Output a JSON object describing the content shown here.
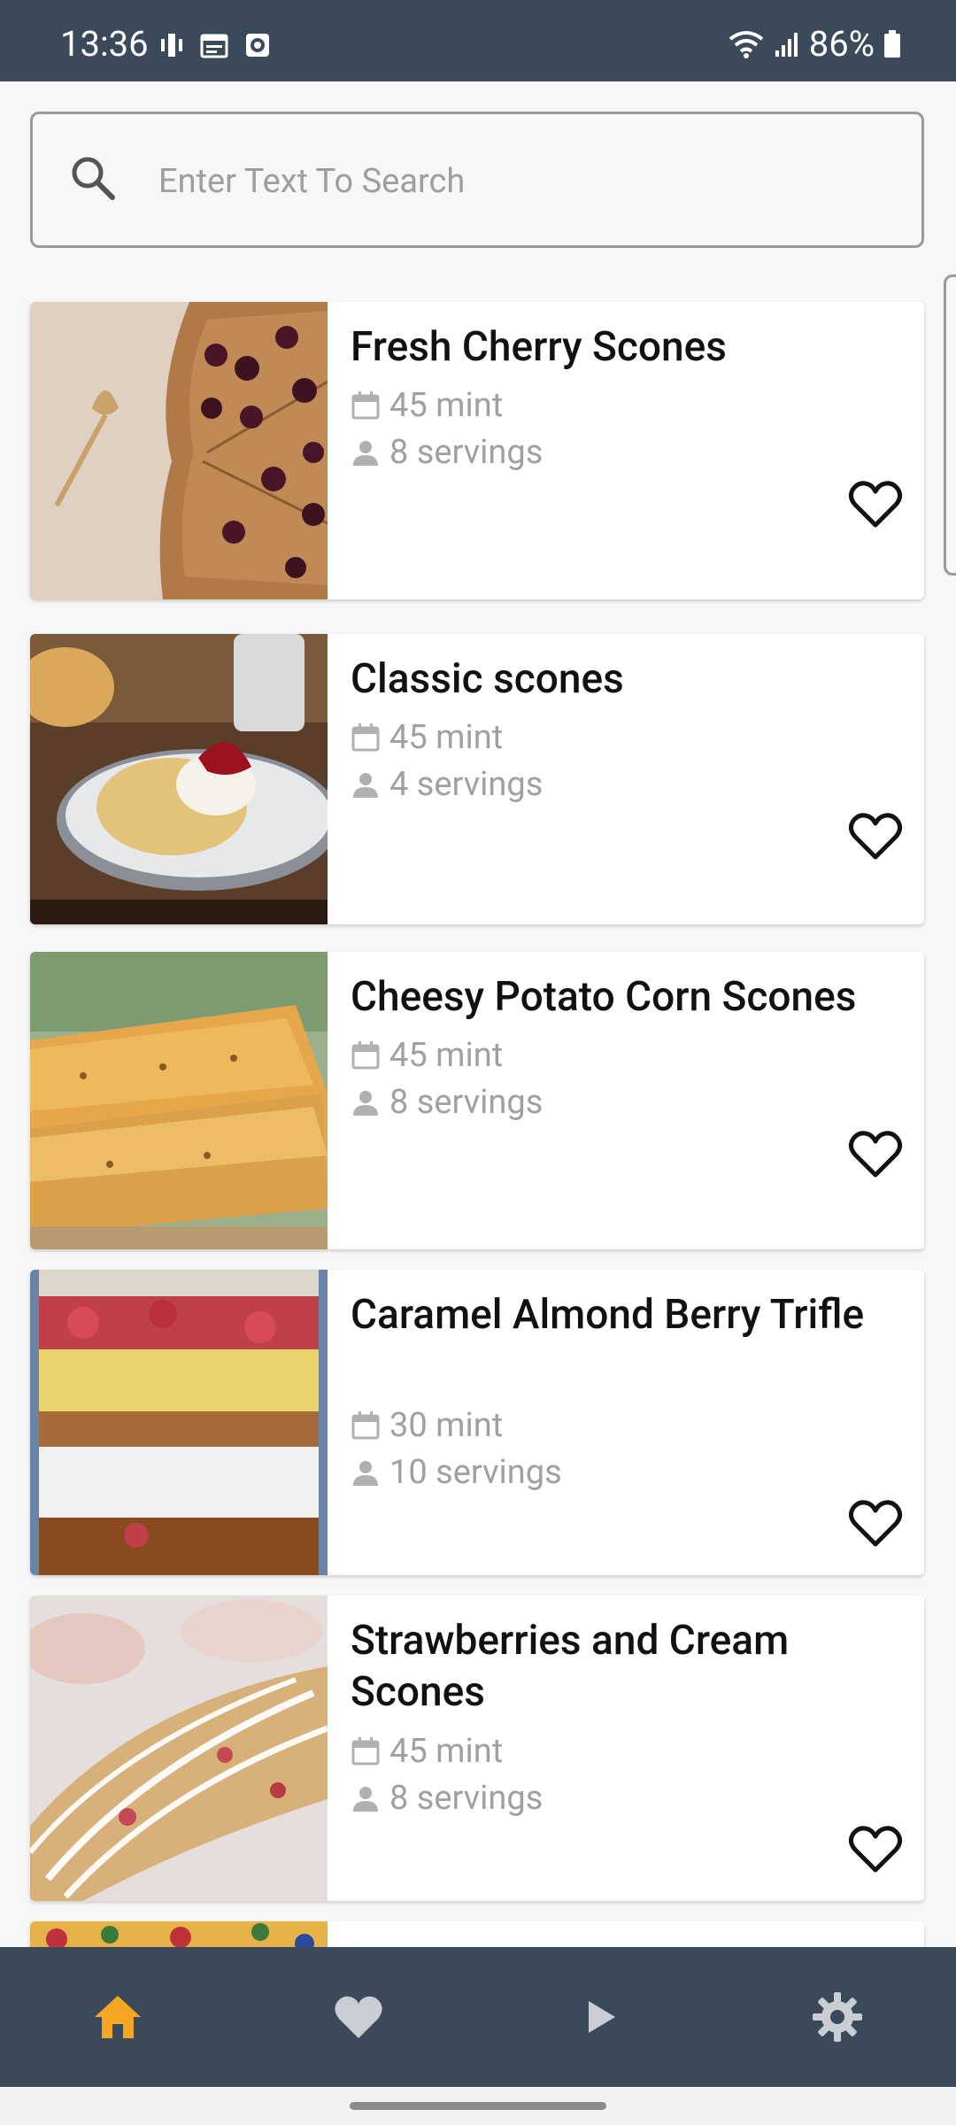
{
  "status_bar": {
    "time": "13:36",
    "battery": "86%"
  },
  "search": {
    "placeholder": "Enter Text To Search"
  },
  "recipes": [
    {
      "title": "Fresh Cherry Scones",
      "time": "45 mint",
      "servings": "8 servings"
    },
    {
      "title": "Classic scones",
      "time": "45 mint",
      "servings": "4 servings"
    },
    {
      "title": "Cheesy Potato Corn Scones",
      "time": "45 mint",
      "servings": "8 servings"
    },
    {
      "title": "Caramel Almond Berry Trifle",
      "time": "30 mint",
      "servings": "10 servings"
    },
    {
      "title": "Strawberries and Cream Scones",
      "time": "45 mint",
      "servings": "8 servings"
    }
  ],
  "bottom_nav": {
    "items": [
      {
        "name": "home",
        "icon": "home-icon",
        "active": true
      },
      {
        "name": "favorites",
        "icon": "heart-icon",
        "active": false
      },
      {
        "name": "videos",
        "icon": "play-icon",
        "active": false
      },
      {
        "name": "settings",
        "icon": "gear-icon",
        "active": false
      }
    ],
    "active_color": "#f5a623",
    "inactive_color": "#c9ced4"
  }
}
